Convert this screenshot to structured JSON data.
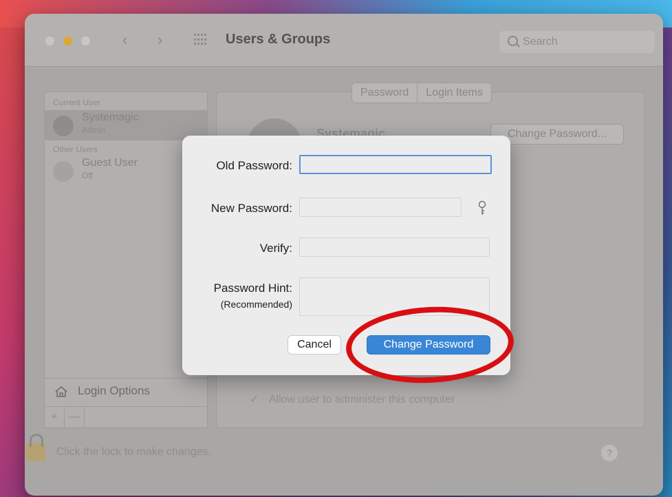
{
  "window": {
    "title": "Users & Groups",
    "search_placeholder": "Search",
    "nav_back": "‹",
    "nav_forward": "›"
  },
  "sidebar": {
    "current_user_header": "Current User",
    "current_user": {
      "name": "Systemagic",
      "role": "Admin"
    },
    "other_users_header": "Other Users",
    "other_users": [
      {
        "name": "Guest User",
        "status": "Off"
      }
    ],
    "login_options": "Login Options",
    "add_button": "+",
    "remove_button": "—"
  },
  "content": {
    "tabs": [
      "Password",
      "Login Items"
    ],
    "user_name": "Systemagic",
    "change_password_button": "Change Password...",
    "allow_admin": "Allow user to administer this computer"
  },
  "footer": {
    "lock_text": "Click the lock to make changes.",
    "help": "?"
  },
  "dialog": {
    "old_password_label": "Old Password:",
    "new_password_label": "New Password:",
    "verify_label": "Verify:",
    "hint_label": "Password Hint:",
    "hint_sub_label": "(Recommended)",
    "old_password_value": "",
    "new_password_value": "",
    "verify_value": "",
    "hint_value": "",
    "cancel_label": "Cancel",
    "change_label": "Change Password"
  },
  "colors": {
    "primary_button": "#3a86d6",
    "focus_ring": "#5b91d6",
    "annotation_ring": "#d80f12"
  }
}
